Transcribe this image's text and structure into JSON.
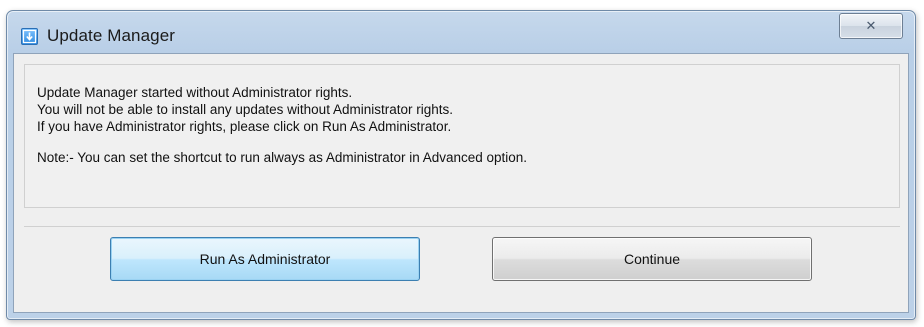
{
  "window": {
    "title": "Update Manager",
    "close_glyph": "✕"
  },
  "message": {
    "line1": "Update Manager started without Administrator rights.",
    "line2": "You will not be able to install any updates without Administrator rights.",
    "line3": "If you have Administrator rights, please click on Run As Administrator.",
    "note": "Note:- You can set the shortcut to run always as Administrator in Advanced option."
  },
  "buttons": {
    "run_as_admin": "Run As Administrator",
    "continue": "Continue"
  },
  "icons": {
    "app": "update-manager-icon",
    "close": "close-icon"
  }
}
